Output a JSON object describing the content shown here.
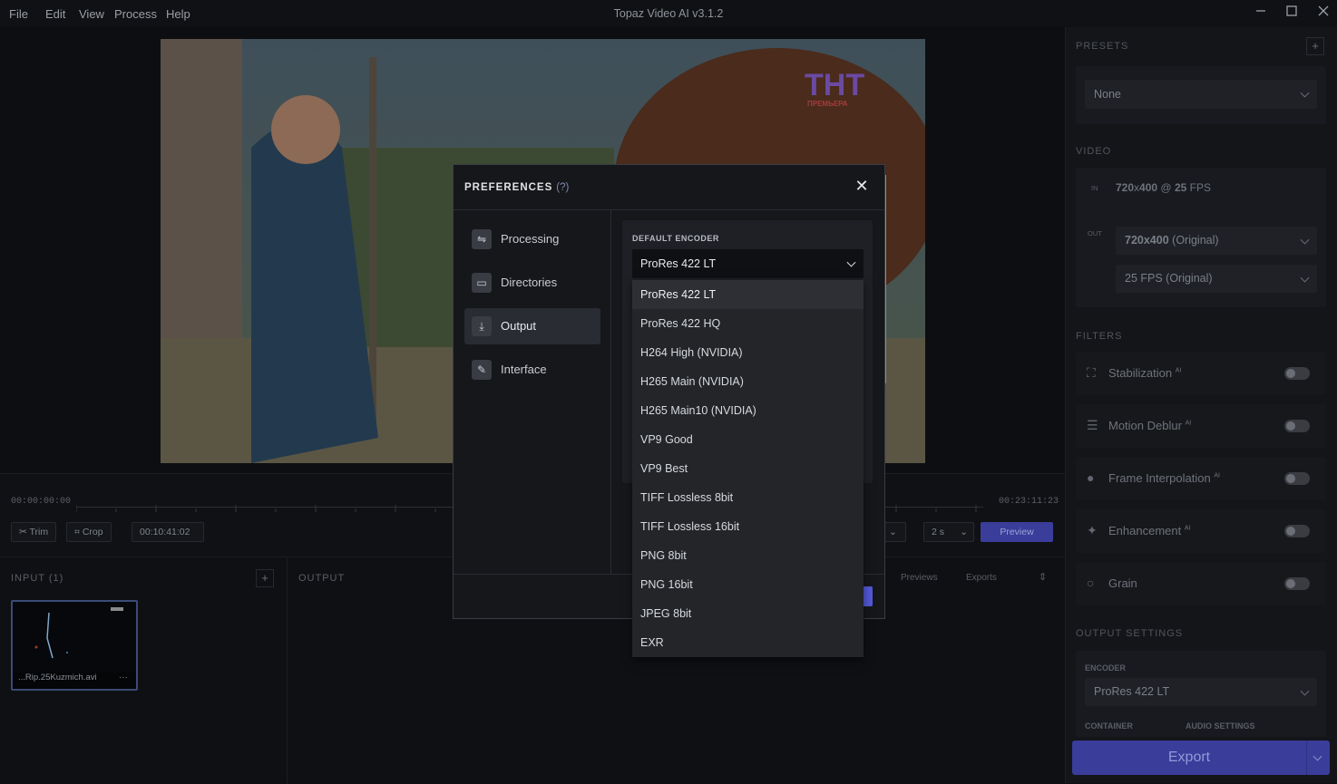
{
  "app": {
    "title": "Topaz Video AI  v3.1.2",
    "menu": [
      "File",
      "Edit",
      "View",
      "Process",
      "Help"
    ]
  },
  "timeline": {
    "start_time": "00:00:00:00",
    "end_time": "00:23:11:23",
    "trim_label": "Trim",
    "crop_label": "Crop",
    "current_time": "00:10:41:02",
    "step_value": "2 s",
    "preview_label": "Preview"
  },
  "input": {
    "header": "INPUT (1)",
    "file_name": "...Rip.25Kuzmich.avi",
    "more": "···"
  },
  "output": {
    "header": "OUTPUT",
    "tab_previews": "Previews",
    "tab_exports": "Exports"
  },
  "video_overlay": {
    "logo_text": "ТНТ",
    "logo_sub": "ПРЕМЬЕРА"
  },
  "right_panel": {
    "presets_label": "PRESETS",
    "preset_value": "None",
    "video_label": "VIDEO",
    "in_tag": "IN",
    "in_res": "720",
    "in_x": "x",
    "in_res2": "400",
    "in_at": "@",
    "in_fps": "25",
    "in_fps_unit": "FPS",
    "out_tag": "OUT",
    "out_res": "720x400",
    "out_res_suffix": "(Original)",
    "out_fps": "25 FPS (Original)",
    "filters_label": "FILTERS",
    "filters": [
      {
        "label": "Stabilization",
        "ai": "AI",
        "icon": "stabilization-icon",
        "glyph": "⛶"
      },
      {
        "label": "Motion Deblur",
        "ai": "AI",
        "icon": "motion-deblur-icon",
        "glyph": "☰"
      },
      {
        "label": "Frame Interpolation",
        "ai": "AI",
        "icon": "frame-interpolation-icon",
        "glyph": "●"
      },
      {
        "label": "Enhancement",
        "ai": "AI",
        "icon": "enhancement-icon",
        "glyph": "✦"
      },
      {
        "label": "Grain",
        "ai": "",
        "icon": "grain-icon",
        "glyph": "○"
      }
    ],
    "output_settings_label": "OUTPUT SETTINGS",
    "encoder_label": "ENCODER",
    "encoder_value": "ProRes 422 LT",
    "container_label": "CONTAINER",
    "audio_settings_label": "AUDIO SETTINGS",
    "export_label": "Export",
    "add_preset": "+"
  },
  "dialog": {
    "title": "PREFERENCES",
    "help": "(?)",
    "close": "✕",
    "nav": [
      {
        "label": "Processing",
        "icon": "processing-icon",
        "glyph": "⇋"
      },
      {
        "label": "Directories",
        "icon": "folder-icon",
        "glyph": "▭"
      },
      {
        "label": "Output",
        "icon": "download-icon",
        "glyph": "⤓"
      },
      {
        "label": "Interface",
        "icon": "interface-icon",
        "glyph": "✎"
      }
    ],
    "active_nav": "Output",
    "encoder_section_label": "DEFAULT ENCODER",
    "encoder_selected": "ProRes 422 LT",
    "encoder_options": [
      "ProRes 422 LT",
      "ProRes 422 HQ",
      "H264 High (NVIDIA)",
      "H265 Main (NVIDIA)",
      "H265 Main10 (NVIDIA)",
      "VP9 Good",
      "VP9 Best",
      "TIFF Lossless 8bit",
      "TIFF Lossless 16bit",
      "PNG 8bit",
      "PNG 16bit",
      "JPEG 8bit",
      "EXR"
    ]
  },
  "colors": {
    "accent": "#3a3d99",
    "background": "#0d0e11",
    "dialog_bg": "#16171b"
  }
}
